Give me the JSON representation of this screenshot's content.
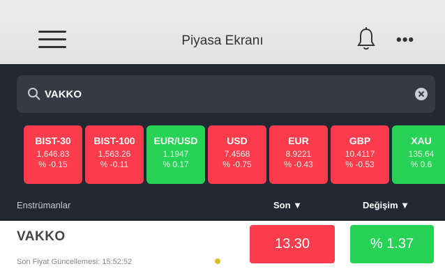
{
  "app": {
    "title": "Piyasa Ekranı",
    "icons": [
      "menu-icon",
      "bell-icon",
      "more-icon"
    ]
  },
  "search": {
    "value": "VAKKO",
    "icons": [
      "search-icon",
      "clear-icon"
    ]
  },
  "tiles": [
    {
      "symbol": "BIST-30",
      "price": "1,646.83",
      "change": "% -0.15",
      "color": "#fa3c4d"
    },
    {
      "symbol": "BIST-100",
      "price": "1,563.26",
      "change": "% -0.11",
      "color": "#fa3c4d"
    },
    {
      "symbol": "EUR/USD",
      "price": "1.1947",
      "change": "% 0.17",
      "color": "#26d354"
    },
    {
      "symbol": "USD",
      "price": "7.4568",
      "change": "% -0.75",
      "color": "#fa3c4d"
    },
    {
      "symbol": "EUR",
      "price": "8.9221",
      "change": "% -0.43",
      "color": "#fa3c4d"
    },
    {
      "symbol": "GBP",
      "price": "10.4117",
      "change": "% -0.53",
      "color": "#fa3c4d"
    },
    {
      "symbol": "XAU",
      "price": "135.64",
      "change": "% 0.6",
      "color": "#26d354"
    }
  ],
  "columns": {
    "instruments": "Enstrümanlar",
    "last": "Son ▼",
    "change": "Değişim ▼"
  },
  "row": {
    "name": "VAKKO",
    "updated": "Son Fiyat Güncellemesi: 15:52:52",
    "price": "13.30",
    "change": "% 1.37",
    "status_dot_color": "#d8c02b",
    "price_color": "#fa3c4d",
    "change_color": "#26d354"
  }
}
